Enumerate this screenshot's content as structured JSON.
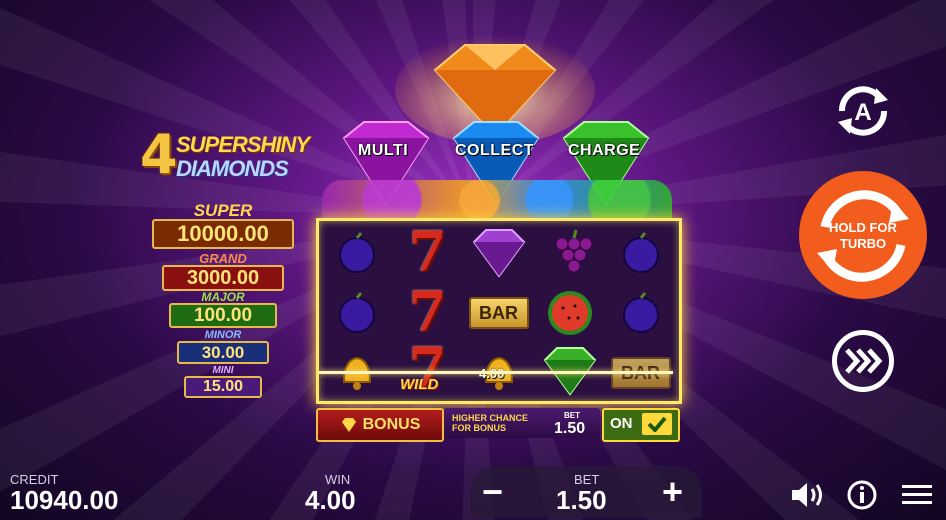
{
  "logo": {
    "number": "4",
    "line1": "SUPERSHINY",
    "line2": "DIAMONDS"
  },
  "jackpots": [
    {
      "name": "SUPER",
      "value": "10000.00",
      "name_color": "#ffd84a",
      "box_color": "#7a2b00",
      "text_color": "#ffe27a"
    },
    {
      "name": "GRAND",
      "value": "3000.00",
      "name_color": "#ff8a4a",
      "box_color": "#8a0f0f",
      "text_color": "#ffe27a"
    },
    {
      "name": "MAJOR",
      "value": "100.00",
      "name_color": "#9ae04a",
      "box_color": "#1f6b12",
      "text_color": "#ffe27a"
    },
    {
      "name": "MINOR",
      "value": "30.00",
      "name_color": "#8ab8ff",
      "box_color": "#1a2f7a",
      "text_color": "#ffe27a"
    },
    {
      "name": "MINI",
      "value": "15.00",
      "name_color": "#e0b0ff",
      "box_color": "#4a1a7a",
      "text_color": "#ffe27a"
    }
  ],
  "gems": {
    "multi": "MULTI",
    "collect": "COLLECT",
    "charge": "CHARGE"
  },
  "reels": {
    "coin_values": [
      "4.00"
    ],
    "wild_label": "WILD",
    "bar_label": "BAR"
  },
  "bonus": {
    "button_label": "BONUS",
    "chance_line1": "HIGHER CHANCE",
    "chance_line2": "FOR BONUS",
    "bet_label": "BET",
    "bet_value": "1.50",
    "toggle_label": "ON"
  },
  "controls": {
    "turbo_line1": "HOLD FOR",
    "turbo_line2": "TURBO"
  },
  "footer": {
    "credit_label": "CREDIT",
    "credit_value": "10940.00",
    "win_label": "WIN",
    "win_value": "4.00",
    "bet_label": "BET",
    "bet_value": "1.50",
    "minus": "−",
    "plus": "+"
  },
  "icons": [
    "autoplay-icon",
    "turbo-icon",
    "fast-forward-icon",
    "sound-icon",
    "info-icon",
    "menu-icon",
    "diamond-icon",
    "check-icon"
  ]
}
